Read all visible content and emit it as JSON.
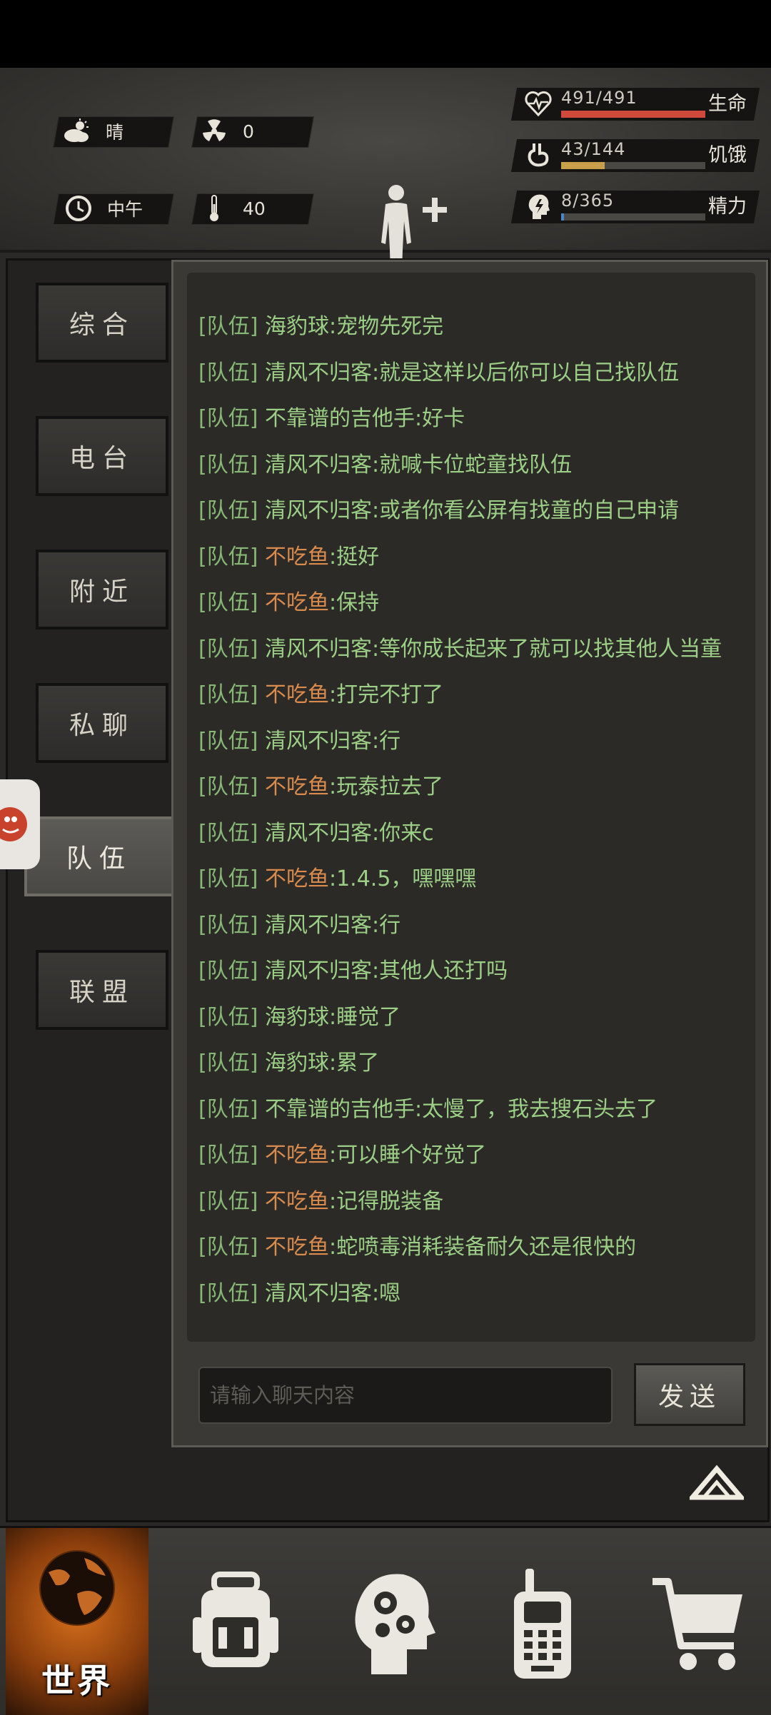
{
  "status": {
    "weather": "晴",
    "radiation": "0",
    "time_of_day": "中午",
    "temperature": "40"
  },
  "stats": {
    "health": {
      "value": "491/491",
      "label": "生命",
      "fraction": 1.0,
      "color": "#d04a3c"
    },
    "hunger": {
      "value": "43/144",
      "label": "饥饿",
      "fraction": 0.3,
      "color": "#c8a04a"
    },
    "energy": {
      "value": "8/365",
      "label": "精力",
      "fraction": 0.02,
      "color": "#4a86c8"
    }
  },
  "tabs": [
    {
      "label": "综合"
    },
    {
      "label": "电台"
    },
    {
      "label": "附近"
    },
    {
      "label": "私聊"
    },
    {
      "label": "队伍"
    },
    {
      "label": "联盟"
    }
  ],
  "messages": [
    {
      "tag": "[队伍]",
      "name": "海豹球",
      "name_color": "green",
      "text": ":宠物先死完"
    },
    {
      "tag": "[队伍]",
      "name": "清风不归客",
      "name_color": "green",
      "text": ":就是这样以后你可以自己找队伍"
    },
    {
      "tag": "[队伍]",
      "name": "不靠谱的吉他手",
      "name_color": "green",
      "text": ":好卡"
    },
    {
      "tag": "[队伍]",
      "name": "清风不归客",
      "name_color": "green",
      "text": ":就喊卡位蛇童找队伍"
    },
    {
      "tag": "[队伍]",
      "name": "清风不归客",
      "name_color": "green",
      "text": ":或者你看公屏有找童的自己申请"
    },
    {
      "tag": "[队伍]",
      "name": "不吃鱼",
      "name_color": "orange",
      "text": ":挺好"
    },
    {
      "tag": "[队伍]",
      "name": "不吃鱼",
      "name_color": "orange",
      "text": ":保持"
    },
    {
      "tag": "[队伍]",
      "name": "清风不归客",
      "name_color": "green",
      "text": ":等你成长起来了就可以找其他人当童"
    },
    {
      "tag": "[队伍]",
      "name": "不吃鱼",
      "name_color": "orange",
      "text": ":打完不打了"
    },
    {
      "tag": "[队伍]",
      "name": "清风不归客",
      "name_color": "green",
      "text": ":行"
    },
    {
      "tag": "[队伍]",
      "name": "不吃鱼",
      "name_color": "orange",
      "text": ":玩泰拉去了"
    },
    {
      "tag": "[队伍]",
      "name": "清风不归客",
      "name_color": "green",
      "text": ":你来c"
    },
    {
      "tag": "[队伍]",
      "name": "不吃鱼",
      "name_color": "orange",
      "text": ":1.4.5，嘿嘿嘿"
    },
    {
      "tag": "[队伍]",
      "name": "清风不归客",
      "name_color": "green",
      "text": ":行"
    },
    {
      "tag": "[队伍]",
      "name": "清风不归客",
      "name_color": "green",
      "text": ":其他人还打吗"
    },
    {
      "tag": "[队伍]",
      "name": "海豹球",
      "name_color": "green",
      "text": ":睡觉了"
    },
    {
      "tag": "[队伍]",
      "name": "海豹球",
      "name_color": "green",
      "text": ":累了"
    },
    {
      "tag": "[队伍]",
      "name": "不靠谱的吉他手",
      "name_color": "green",
      "text": ":太慢了，我去搜石头去了"
    },
    {
      "tag": "[队伍]",
      "name": "不吃鱼",
      "name_color": "orange",
      "text": ":可以睡个好觉了"
    },
    {
      "tag": "[队伍]",
      "name": "不吃鱼",
      "name_color": "orange",
      "text": ":记得脱装备"
    },
    {
      "tag": "[队伍]",
      "name": "不吃鱼",
      "name_color": "orange",
      "text": ":蛇喷毒消耗装备耐久还是很快的"
    },
    {
      "tag": "[队伍]",
      "name": "清风不归客",
      "name_color": "green",
      "text": ":嗯"
    }
  ],
  "chat_input": {
    "placeholder": "请输入聊天内容"
  },
  "send_label": "发送",
  "bottom_nav": {
    "world_label": "世界"
  }
}
